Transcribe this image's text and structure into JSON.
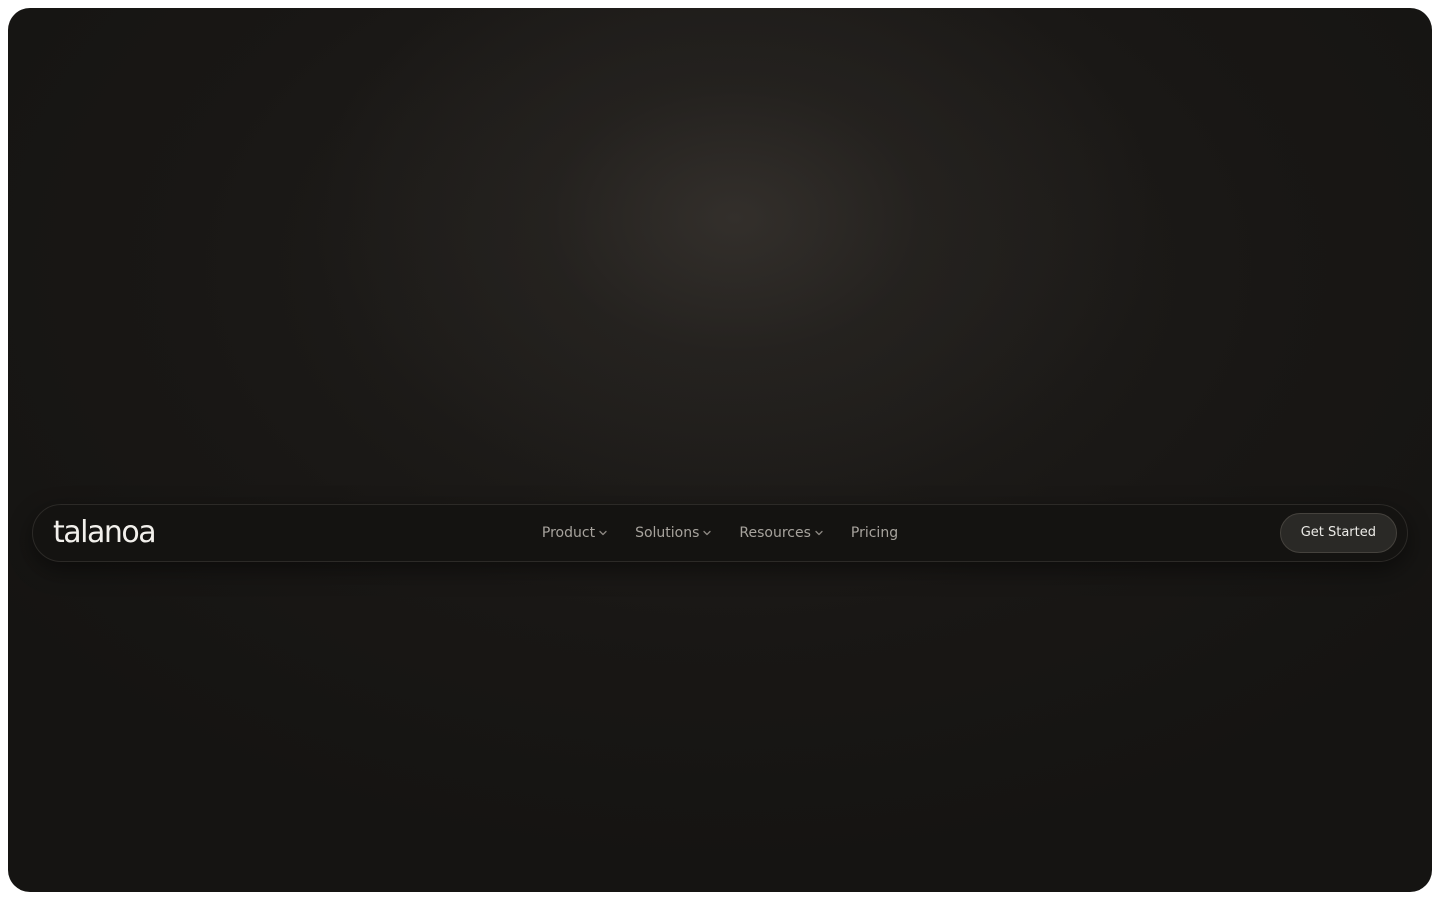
{
  "brand": {
    "logo_text": "talanoa"
  },
  "nav": {
    "items": [
      {
        "label": "Product",
        "has_dropdown": true
      },
      {
        "label": "Solutions",
        "has_dropdown": true
      },
      {
        "label": "Resources",
        "has_dropdown": true
      },
      {
        "label": "Pricing",
        "has_dropdown": false
      }
    ],
    "cta_label": "Get Started"
  },
  "colors": {
    "background": "#171614",
    "navbar": "#141311",
    "nav_text": "#a7a39d",
    "logo_text": "#f2f0ec",
    "cta_bg": "#2a2926",
    "cta_text": "#ecebe7"
  },
  "icons": {
    "dropdown": "chevron-down-icon"
  }
}
